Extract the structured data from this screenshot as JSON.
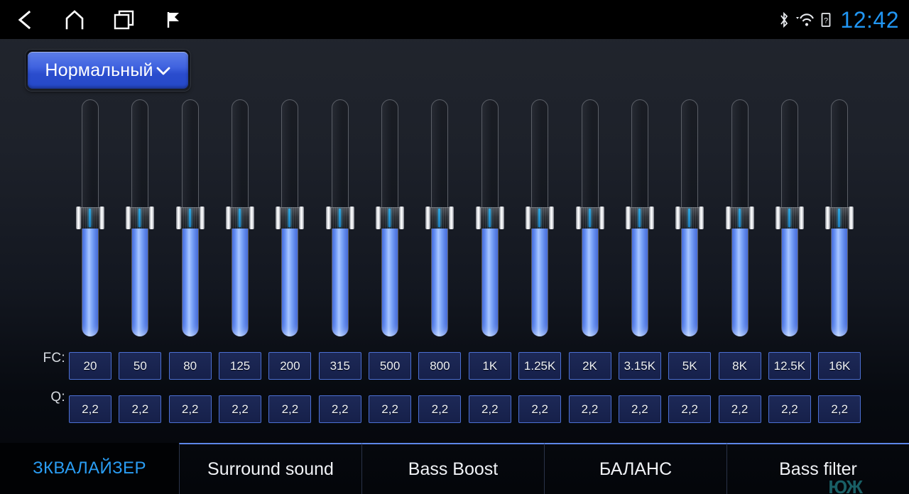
{
  "statusbar": {
    "nav": [
      {
        "name": "back-icon",
        "label": "back"
      },
      {
        "name": "home-icon",
        "label": "home"
      },
      {
        "name": "recents-icon",
        "label": "recent apps"
      },
      {
        "name": "flag-icon",
        "label": "flag"
      }
    ],
    "icons": [
      {
        "name": "bluetooth-icon",
        "label": "bluetooth"
      },
      {
        "name": "wifi-icon",
        "label": "wifi"
      },
      {
        "name": "battery-icon",
        "label": "battery"
      }
    ],
    "clock": "12:42",
    "clock_color": "#2196f3"
  },
  "preset": {
    "label": "Нормальный",
    "chevron": "chevron-down-icon",
    "accent": "#3f62df"
  },
  "equalizer": {
    "fc_label": "FC:",
    "q_label": "Q:",
    "bands": [
      {
        "fc": "20",
        "q": "2,2",
        "value": 50
      },
      {
        "fc": "50",
        "q": "2,2",
        "value": 50
      },
      {
        "fc": "80",
        "q": "2,2",
        "value": 50
      },
      {
        "fc": "125",
        "q": "2,2",
        "value": 50
      },
      {
        "fc": "200",
        "q": "2,2",
        "value": 50
      },
      {
        "fc": "315",
        "q": "2,2",
        "value": 50
      },
      {
        "fc": "500",
        "q": "2,2",
        "value": 50
      },
      {
        "fc": "800",
        "q": "2,2",
        "value": 50
      },
      {
        "fc": "1K",
        "q": "2,2",
        "value": 50
      },
      {
        "fc": "1.25K",
        "q": "2,2",
        "value": 50
      },
      {
        "fc": "2K",
        "q": "2,2",
        "value": 50
      },
      {
        "fc": "3.15K",
        "q": "2,2",
        "value": 50
      },
      {
        "fc": "5K",
        "q": "2,2",
        "value": 50
      },
      {
        "fc": "8K",
        "q": "2,2",
        "value": 50
      },
      {
        "fc": "12.5K",
        "q": "2,2",
        "value": 50
      },
      {
        "fc": "16K",
        "q": "2,2",
        "value": 50
      }
    ]
  },
  "tabs": [
    {
      "label": "ЗКВАЛАЙЗЕР",
      "active": true
    },
    {
      "label": "Surround sound",
      "active": false
    },
    {
      "label": "Bass Boost",
      "active": false
    },
    {
      "label": "БАЛАНС",
      "active": false
    },
    {
      "label": "Bass filter",
      "active": false
    }
  ],
  "watermark": "ЮЖ"
}
